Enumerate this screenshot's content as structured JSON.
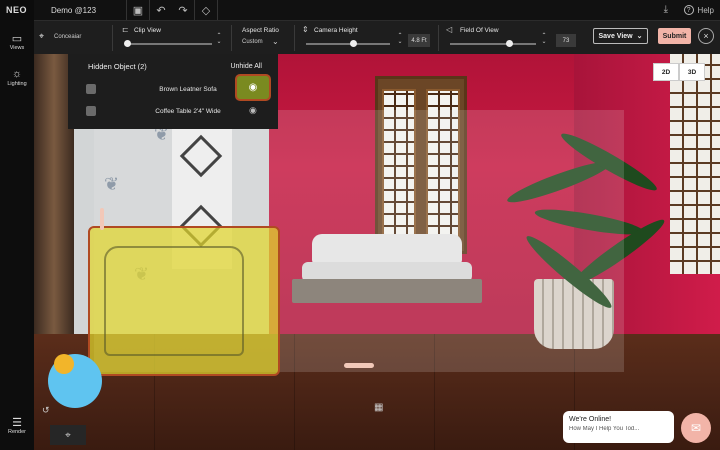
{
  "app": {
    "logo": "NEO",
    "doc_title": "Demo @123",
    "help_label": "Help"
  },
  "toolbar": {
    "conceal_label": "Conceaiar",
    "clip_view": "Clip View",
    "aspect_ratio": "Aspect Ratio",
    "aspect_value": "Custom",
    "camera_height": "Camera Height",
    "camera_height_value": "4.8 Ft",
    "field_of_view": "Field Of View",
    "fov_value": "73",
    "save_view": "Save View",
    "submit": "Submit"
  },
  "sidebar": {
    "items": [
      {
        "label": "Views",
        "icon": "camera-icon"
      },
      {
        "label": "Lighting",
        "icon": "sun-icon"
      }
    ],
    "render_label": "Render"
  },
  "view_toggle": {
    "two_d": "2D",
    "three_d": "3D"
  },
  "hidden_panel": {
    "title": "Hidden Object",
    "count": "(2)",
    "unhide_all": "Unhide All",
    "items": [
      {
        "name": "Brown Leatner Sofa",
        "visible": false
      },
      {
        "name": "Coffee Table 2'4\" Wide",
        "visible": false
      }
    ]
  },
  "chat": {
    "title": "We're Online!",
    "subtitle": "How May I Help You Tod..."
  },
  "colors": {
    "accent": "#f2b4a8",
    "highlight": "#b04a22",
    "wall": "#c71a42"
  }
}
